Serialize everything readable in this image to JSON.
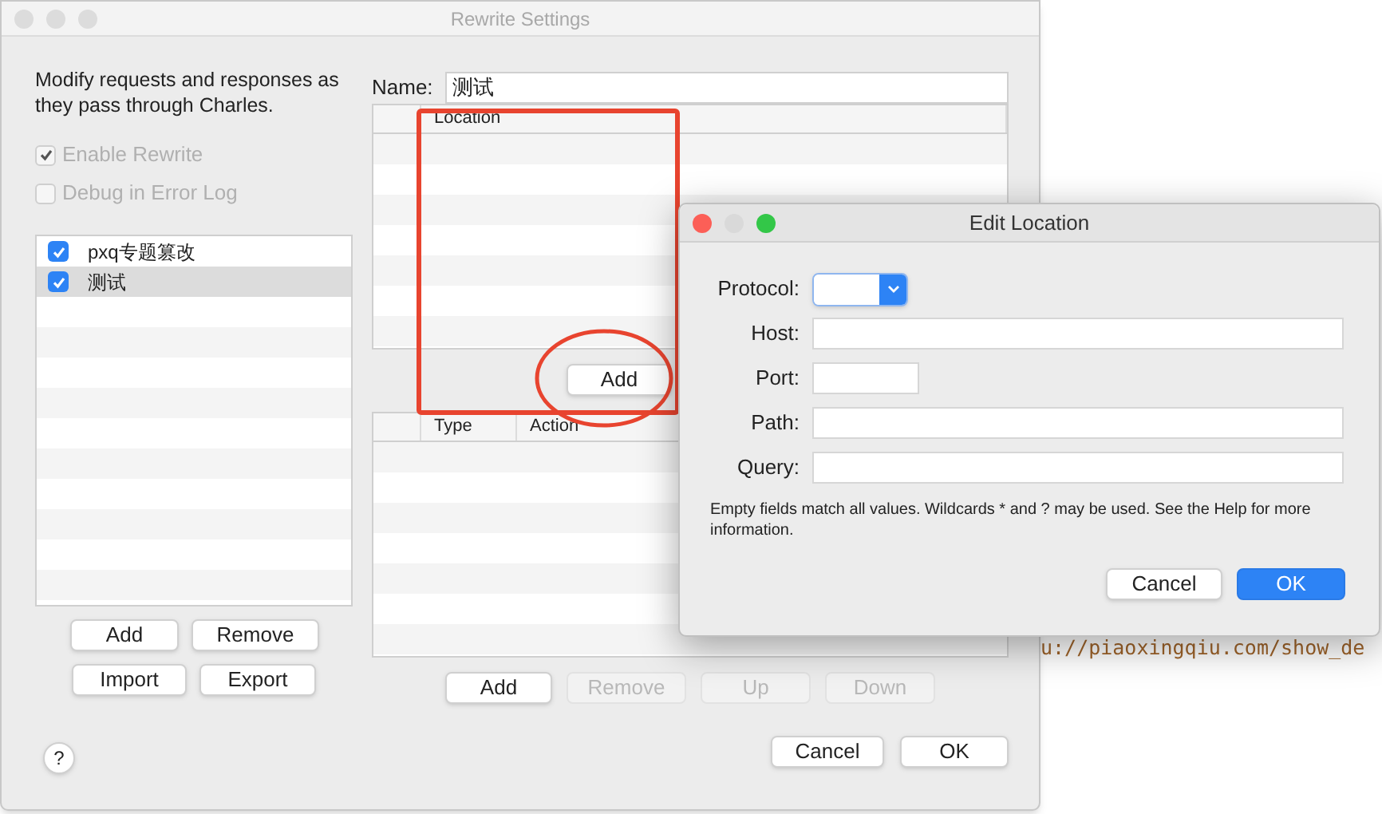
{
  "main_window": {
    "title": "Rewrite Settings",
    "description": "Modify requests and responses as they pass through Charles.",
    "options": [
      {
        "label": "Enable Rewrite",
        "checked": true,
        "disabled": true
      },
      {
        "label": "Debug in Error Log",
        "checked": false,
        "disabled": true
      }
    ],
    "rule_sets": [
      {
        "label": "pxq专题篡改",
        "checked": true,
        "selected": false
      },
      {
        "label": "测试",
        "checked": true,
        "selected": true
      }
    ],
    "set_buttons": [
      "Add",
      "Remove",
      "Import",
      "Export"
    ],
    "help": "?",
    "name_label": "Name:",
    "name_value": "测试",
    "locations_table": {
      "columns": [
        "Location"
      ]
    },
    "location_buttons": [
      {
        "label": "Add",
        "disabled": false
      }
    ],
    "rules_table": {
      "columns": [
        "Type",
        "Action"
      ]
    },
    "rule_buttons": [
      {
        "label": "Add",
        "disabled": false
      },
      {
        "label": "Remove",
        "disabled": true
      },
      {
        "label": "Up",
        "disabled": true
      },
      {
        "label": "Down",
        "disabled": true
      }
    ],
    "footer_buttons": [
      {
        "label": "Cancel",
        "default": false
      },
      {
        "label": "OK",
        "default": false
      }
    ]
  },
  "edit_location": {
    "title": "Edit Location",
    "fields": [
      {
        "label": "Protocol:",
        "kind": "select"
      },
      {
        "label": "Host:",
        "kind": "text"
      },
      {
        "label": "Port:",
        "kind": "short"
      },
      {
        "label": "Path:",
        "kind": "text"
      },
      {
        "label": "Query:",
        "kind": "text"
      }
    ],
    "note": "Empty fields match all values. Wildcards * and ? may be used. See the Help for more information.",
    "buttons": [
      {
        "label": "Cancel",
        "default": false
      },
      {
        "label": "OK",
        "default": true
      }
    ]
  },
  "background_editor": {
    "line": "u://piaoxingqiu.com/show_de"
  }
}
